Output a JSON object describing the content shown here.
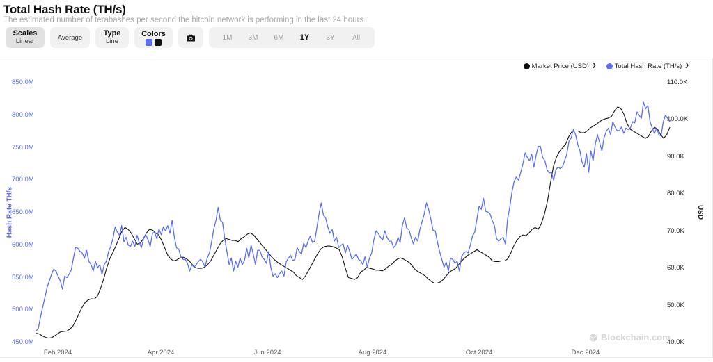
{
  "header": {
    "title": "Total Hash Rate (TH/s)",
    "subtitle": "The estimated number of terahashes per second the bitcoin network is performing in the last 24 hours."
  },
  "toolbar": {
    "scales_label": "Scales",
    "scales_value": "Linear",
    "average_label": "Average",
    "type_label": "Type",
    "type_value": "Line",
    "colors_label": "Colors",
    "color_primary": "#5b6ef2",
    "color_secondary": "#111111",
    "camera_icon": "camera-icon",
    "ranges": [
      "1M",
      "3M",
      "6M",
      "1Y",
      "3Y",
      "All"
    ],
    "selected_range": "1Y"
  },
  "watermark": "Blockchain.com",
  "chart_data": {
    "type": "line",
    "title": "Total Hash Rate (TH/s)",
    "legend": [
      {
        "name": "Market Price (USD)",
        "color": "#111111"
      },
      {
        "name": "Total Hash Rate (TH/s)",
        "color": "#5b6ef2"
      }
    ],
    "legend_position": "top-right",
    "xlabel": "",
    "ylabel_left": "Hash Rate TH/s",
    "ylabel_right": "USD",
    "x_tick_labels": [
      "Feb 2024",
      "Apr 2024",
      "Jun 2024",
      "Aug 2024",
      "Oct 2024",
      "Dec 2024"
    ],
    "left_axis": {
      "ylim": [
        450,
        850
      ],
      "ticks": [
        "450.0M",
        "500.0M",
        "550.0M",
        "600.0M",
        "650.0M",
        "700.0M",
        "750.0M",
        "800.0M",
        "850.0M"
      ],
      "unit": "M TH/s"
    },
    "right_axis": {
      "ylim": [
        40,
        110
      ],
      "ticks": [
        "40.0K",
        "50.0K",
        "60.0K",
        "70.0K",
        "80.0K",
        "90.0K",
        "100.0K",
        "110.0K"
      ],
      "unit": "K USD"
    },
    "x_range": [
      "2024-01-16",
      "2025-01-14"
    ],
    "grid": false,
    "series": [
      {
        "name": "Total Hash Rate (TH/s)",
        "axis": "left",
        "color": "#5b6ef2",
        "values": [
          468,
          472,
          490,
          505,
          520,
          535,
          545,
          555,
          563,
          560,
          552,
          545,
          532,
          552,
          550,
          555,
          562,
          580,
          597,
          595,
          590,
          588,
          580,
          592,
          575,
          570,
          560,
          575,
          565,
          570,
          555,
          570,
          575,
          590,
          598,
          610,
          628,
          620,
          615,
          630,
          605,
          612,
          600,
          598,
          606,
          598,
          615,
          604,
          596,
          610,
          616,
          608,
          598,
          618,
          620,
          610,
          625,
          616,
          628,
          622,
          630,
          618,
          638,
          612,
          596,
          594,
          582,
          578,
          578,
          572,
          560,
          570,
          566,
          570,
          575,
          578,
          574,
          566,
          580,
          588,
          605,
          625,
          638,
          658,
          638,
          635,
          610,
          590,
          570,
          580,
          560,
          575,
          566,
          580,
          570,
          576,
          595,
          580,
          600,
          586,
          570,
          592,
          592,
          582,
          578,
          572,
          590,
          566,
          552,
          556,
          550,
          556,
          560,
          552,
          574,
          580,
          584,
          576,
          578,
          596,
          590,
          586,
          603,
          596,
          606,
          614,
          604,
          606,
          626,
          648,
          665,
          646,
          642,
          628,
          618,
          624,
          606,
          612,
          596,
          600,
          602,
          588,
          600,
          590,
          578,
          582,
          586,
          578,
          576,
          570,
          582,
          566,
          580,
          588,
          608,
          622,
          618,
          612,
          608,
          622,
          612,
          606,
          606,
          596,
          600,
          612,
          604,
          630,
          642,
          626,
          624,
          612,
          602,
          612,
          606,
          624,
          636,
          648,
          665,
          655,
          640,
          623,
          622,
          605,
          590,
          578,
          566,
          574,
          560,
          580,
          578,
          572,
          575,
          560,
          582,
          588,
          590,
          588,
          600,
          614,
          620,
          640,
          660,
          655,
          672,
          652,
          651,
          648,
          638,
          630,
          610,
          606,
          610,
          612,
          602,
          640,
          658,
          682,
          698,
          705,
          700,
          712,
          725,
          742,
          735,
          730,
          740,
          720,
          738,
          752,
          752,
          735,
          730,
          716,
          711,
          712,
          700,
          716,
          720,
          718,
          720,
          730,
          740,
          760,
          765,
          778,
          770,
          755,
          745,
          728,
          720,
          741,
          712,
          745,
          730,
          755,
          770,
          758,
          745,
          765,
          775,
          780,
          770,
          790,
          782,
          776,
          776,
          782,
          772,
          780,
          778,
          780,
          790,
          788,
          805,
          800,
          795,
          820,
          810,
          815,
          790,
          780,
          772,
          780,
          770,
          768,
          790,
          800,
          795,
          790
        ]
      },
      {
        "name": "Market Price (USD)",
        "axis": "right",
        "color": "#111111",
        "values": [
          42.5,
          42.3,
          41.8,
          41.4,
          41.2,
          41.3,
          41.8,
          42.4,
          42.9,
          43.0,
          43.1,
          43.6,
          44.5,
          46.0,
          47.8,
          49.5,
          50.8,
          51.5,
          51.8,
          51.7,
          52.5,
          54.5,
          57.0,
          60.0,
          62.5,
          64.2,
          66.0,
          68.0,
          70.0,
          71.0,
          70.5,
          69.5,
          68.0,
          66.5,
          66.8,
          68.0,
          69.5,
          70.5,
          70.3,
          69.5,
          69.0,
          67.5,
          65.5,
          63.5,
          62.5,
          62.0,
          62.3,
          62.8,
          63.0,
          62.6,
          62.0,
          61.0,
          60.2,
          60.0,
          60.0,
          60.3,
          61.0,
          62.0,
          63.5,
          65.0,
          66.5,
          67.5,
          68.0,
          67.8,
          67.5,
          67.5,
          67.2,
          68.0,
          68.5,
          69.2,
          69.5,
          69.0,
          68.0,
          67.0,
          66.0,
          65.0,
          64.0,
          63.0,
          62.2,
          61.5,
          61.0,
          60.5,
          60.0,
          59.5,
          59.0,
          58.0,
          57.5,
          57.0,
          58.0,
          59.5,
          61.0,
          62.5,
          64.0,
          65.2,
          65.8,
          66.0,
          66.0,
          65.8,
          65.5,
          65.0,
          63.0,
          60.0,
          57.5,
          57.3,
          57.0,
          57.5,
          59.0,
          59.5,
          60.3,
          60.0,
          59.8,
          59.5,
          59.5,
          59.3,
          59.8,
          60.5,
          61.0,
          61.8,
          62.5,
          62.8,
          62.5,
          62.0,
          61.5,
          60.5,
          59.5,
          59.0,
          58.5,
          58.0,
          57.2,
          56.5,
          56.0,
          56.0,
          56.3,
          57.0,
          58.0,
          59.0,
          59.5,
          60.0,
          61.0,
          62.0,
          62.8,
          63.5,
          64.0,
          64.5,
          65.0,
          64.5,
          64.0,
          63.5,
          63.0,
          62.0,
          61.8,
          61.8,
          62.0,
          62.0,
          62.5,
          64.0,
          66.0,
          67.5,
          68.5,
          69.0,
          68.8,
          69.5,
          70.5,
          71.0,
          70.5,
          72.0,
          74.5,
          78.0,
          83.0,
          87.5,
          90.0,
          91.5,
          92.5,
          93.5,
          95.5,
          96.8,
          97.0,
          97.0,
          96.5,
          96.5,
          97.0,
          97.8,
          98.3,
          98.8,
          99.5,
          100.0,
          100.3,
          100.5,
          101.0,
          102.5,
          103.5,
          103.0,
          101.5,
          99.0,
          97.5,
          97.0,
          96.5,
          96.0,
          95.5,
          95.0,
          95.5,
          97.0,
          98.0,
          97.5,
          96.0,
          95.0,
          96.0,
          98.0
        ]
      }
    ]
  }
}
